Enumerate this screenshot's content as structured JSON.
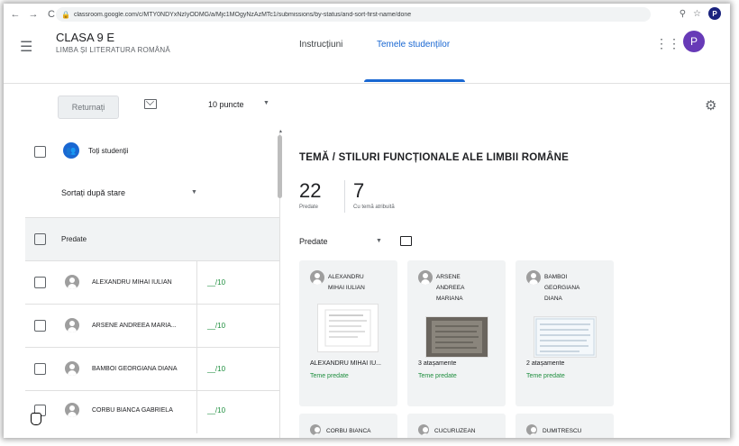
{
  "browser": {
    "url": "classroom.google.com/c/MTY0NDYxNzIyODMG/a/Mjc1MOgyNzAzMTc1/submissions/by-status/and-sort-first-name/done",
    "back": "←",
    "forward": "→",
    "reload": "C",
    "profile_initial": "P"
  },
  "header": {
    "class_name": "CLASA 9 E",
    "class_subject": "LIMBA ȘI LITERATURA ROMÂNĂ",
    "tabs": [
      {
        "label": "Instrucțiuni",
        "active": false
      },
      {
        "label": "Temele studenților",
        "active": true
      }
    ],
    "profile_initial": "P"
  },
  "toolbar": {
    "return_label": "Returnați",
    "points_label": "10 puncte"
  },
  "left": {
    "all_students_label": "Toți studenții",
    "sort_label": "Sortați după stare",
    "section_label": "Predate",
    "students": [
      {
        "name": "ALEXANDRU MIHAI IULIAN",
        "grade": "__/10"
      },
      {
        "name": "ARSENE ANDREEA MARIA...",
        "grade": "__/10"
      },
      {
        "name": "BAMBOI GEORGIANA DIANA",
        "grade": "__/10"
      },
      {
        "name": "CORBU BIANCA GABRIELA",
        "grade": "__/10"
      }
    ]
  },
  "assignment": {
    "title": "TEMĂ / STILURI FUNCȚIONALE ALE LIMBII ROMÂNE",
    "turned_in_count": "22",
    "turned_in_label": "Predate",
    "assigned_count": "7",
    "assigned_label": "Cu temă atribuită",
    "filter_label": "Predate"
  },
  "cards": [
    {
      "name_lines": [
        "ALEXANDRU",
        "MIHAI IULIAN"
      ],
      "caption": "ALEXANDRU MIHAI IU...",
      "status": "Teme predate"
    },
    {
      "name_lines": [
        "ARSENE",
        "ANDREEA",
        "MARIANA"
      ],
      "caption": "3 atașamente",
      "status": "Teme predate"
    },
    {
      "name_lines": [
        "BAMBOI",
        "GEORGIANA",
        "DIANA"
      ],
      "caption": "2 atașamente",
      "status": "Teme predate"
    }
  ],
  "cards_row2": [
    {
      "name": "CORBU BIANCA"
    },
    {
      "name": "CUCURUZEAN"
    },
    {
      "name": "DUMITRESCU"
    }
  ],
  "colors": {
    "accent": "#1967d2",
    "green": "#1e8e3e",
    "profile": "#673ab7"
  }
}
